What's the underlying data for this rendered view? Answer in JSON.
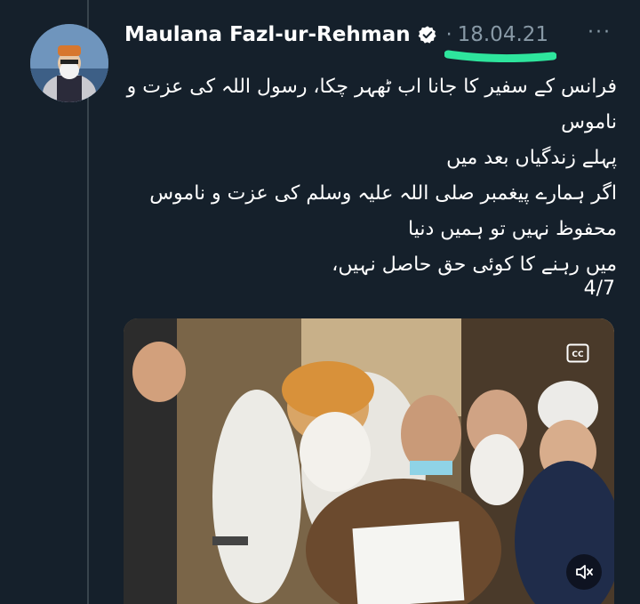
{
  "tweet": {
    "author": "Maulana Fazl-ur-Rehman",
    "separator": "·",
    "date": "18.04.21",
    "more_label": "···",
    "body_lines": [
      "فرانس کے سفیر کا جانا اب ٹھہر چکا، رسول اللہ کی عزت و ناموس",
      "پہلے زندگیاں بعد میں",
      "اگر ہمارے پیغمبر صلی اللہ علیہ وسلم کی عزت و ناموس محفوظ نہیں تو ہمیں دنیا",
      "میں رہنے کا کوئی حق حاصل نہیں،"
    ],
    "thread_counter": "4/7",
    "media": {
      "cc_label": "CC"
    }
  },
  "colors": {
    "background": "#15202b",
    "secondary_text": "#8899a6",
    "highlight": "#2ee59d",
    "verified_badge": "#ffffff"
  },
  "icons": [
    "verified-icon",
    "more-icon",
    "cc-icon",
    "mute-icon"
  ]
}
